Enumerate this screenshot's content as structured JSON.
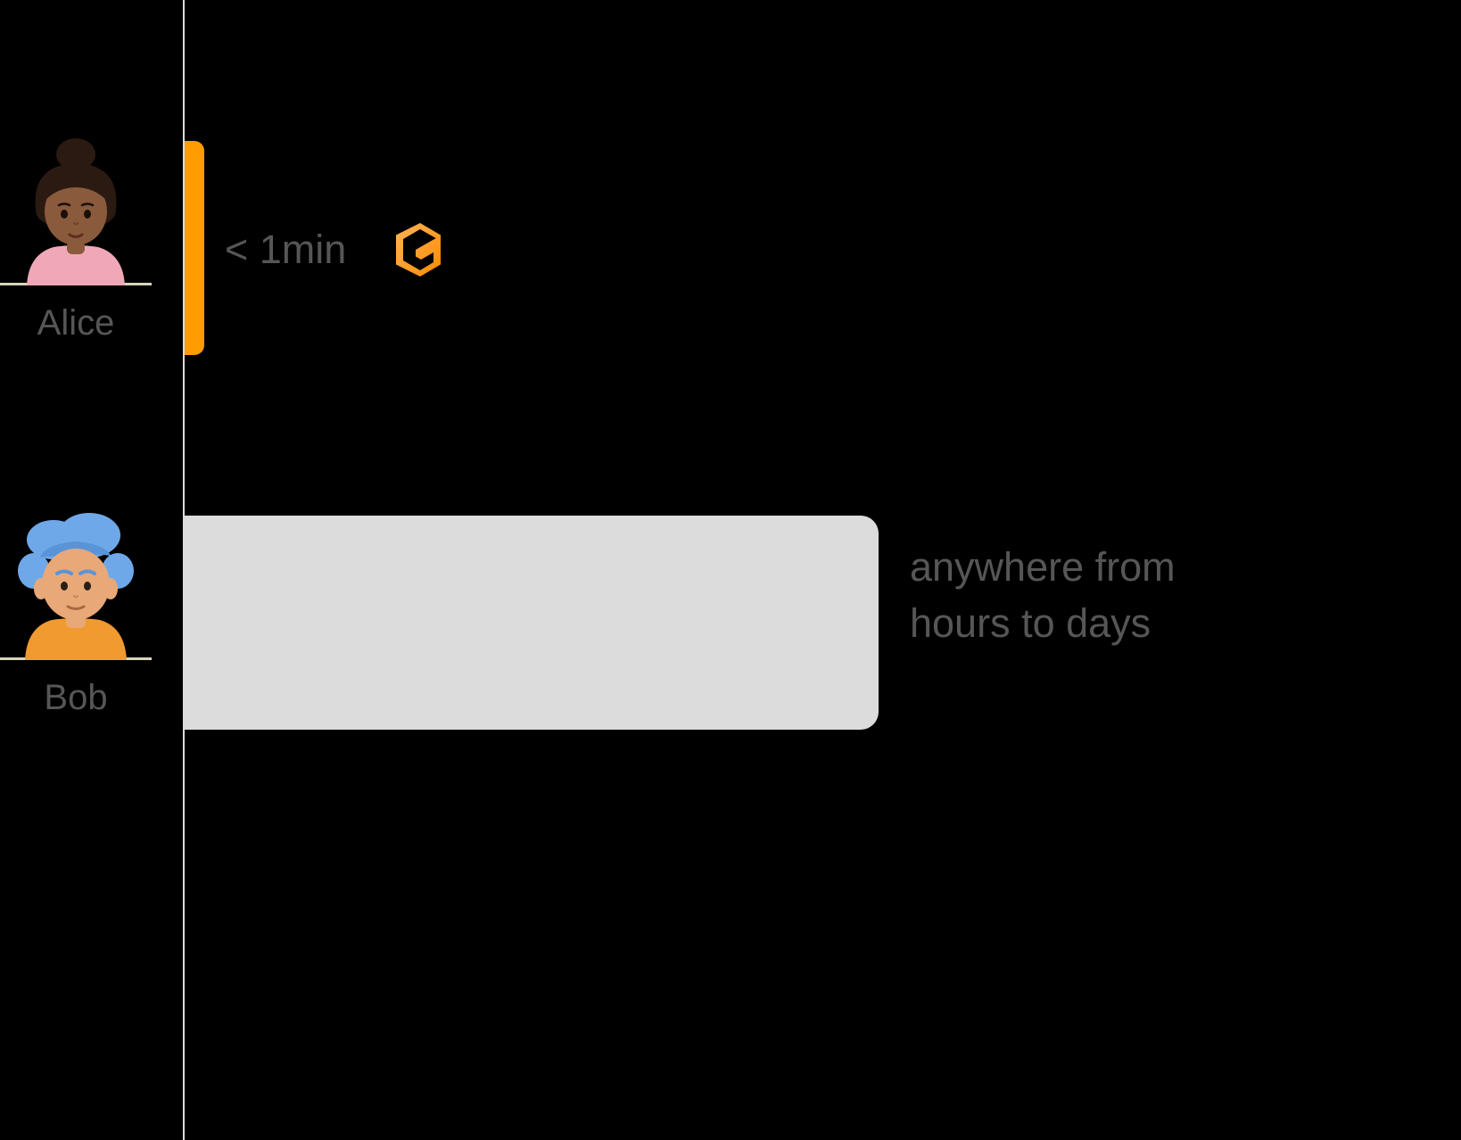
{
  "chart_data": {
    "type": "bar",
    "title": "",
    "xlabel": "",
    "ylabel": "",
    "categories": [
      "Alice",
      "Bob"
    ],
    "series": [
      {
        "name": "time_to_ready",
        "values_label": [
          "< 1min",
          "anywhere from hours to days"
        ],
        "values": [
          0.03,
          1.0
        ]
      }
    ]
  },
  "people": {
    "alice": {
      "name": "Alice",
      "label": "< 1min"
    },
    "bob": {
      "name": "Bob",
      "label": "anywhere from hours to days"
    }
  },
  "colors": {
    "alice_bar": "#ff9c00",
    "bob_bar": "#dcdcdc",
    "text": "#565656",
    "divider": "#dcdcdc",
    "accent_light": "#ffb45b",
    "accent_dark": "#ff8a00"
  },
  "icons": {
    "g_logo": "gitpod-icon"
  }
}
